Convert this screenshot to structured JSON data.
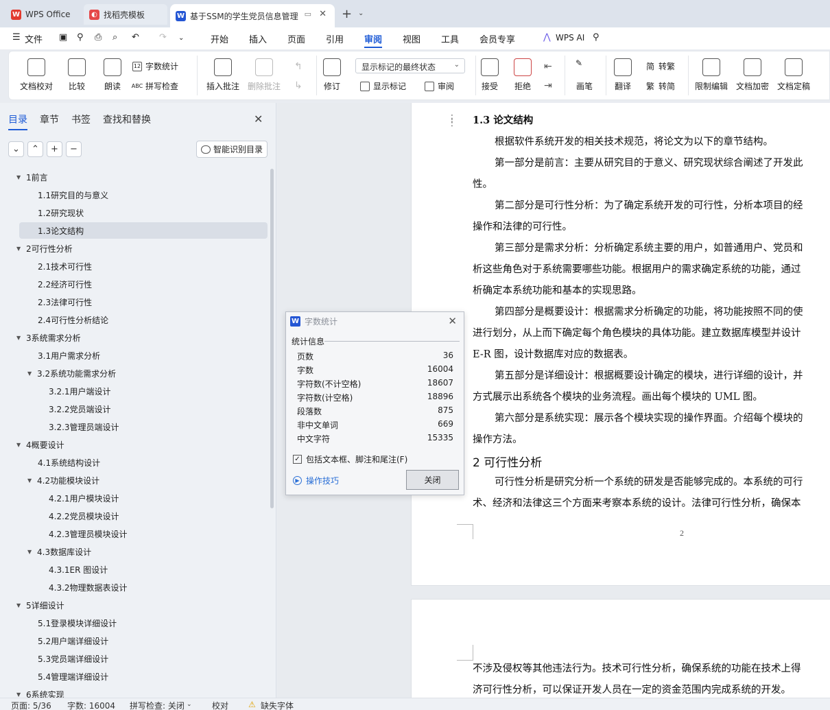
{
  "tabs": {
    "wps_home": "WPS Office",
    "template": "找稻壳模板",
    "document": "基于SSM的学生党员信息管理"
  },
  "menu": {
    "file": "文件",
    "items": [
      "开始",
      "插入",
      "页面",
      "引用",
      "审阅",
      "视图",
      "工具",
      "会员专享"
    ],
    "wps_ai": "WPS AI",
    "active": "审阅"
  },
  "ribbon": {
    "doc_check": "文档校对",
    "compare": "比较",
    "read_aloud": "朗读",
    "word_count": "字数统计",
    "spell_check": "拼写检查",
    "insert_comment": "插入批注",
    "delete_comment": "删除批注",
    "revise": "修订",
    "markup_dropdown": "显示标记的最终状态",
    "show_markup": "显示标记",
    "review": "审阅",
    "accept": "接受",
    "reject": "拒绝",
    "pen": "画笔",
    "translate": "翻译",
    "to_traditional": "转繁",
    "to_simplified": "转简",
    "trad_glyph": "简",
    "simp_glyph": "繁",
    "restrict_edit": "限制编辑",
    "encrypt": "文档加密",
    "finalize": "文档定稿"
  },
  "nav_panel": {
    "tabs": [
      "目录",
      "章节",
      "书签",
      "查找和替换"
    ],
    "active_tab": "目录",
    "smart_toc": "智能识别目录",
    "toc": [
      {
        "label": "1前言",
        "level": 1
      },
      {
        "label": "1.1研究目的与意义",
        "level": 2
      },
      {
        "label": "1.2研究现状",
        "level": 2
      },
      {
        "label": "1.3论文结构",
        "level": 2,
        "selected": true
      },
      {
        "label": "2可行性分析",
        "level": 1
      },
      {
        "label": "2.1技术可行性",
        "level": 2
      },
      {
        "label": "2.2经济可行性",
        "level": 2
      },
      {
        "label": "2.3法律可行性",
        "level": 2
      },
      {
        "label": "2.4可行性分析结论",
        "level": 2
      },
      {
        "label": "3系统需求分析",
        "level": 1
      },
      {
        "label": "3.1用户需求分析",
        "level": 2
      },
      {
        "label": "3.2系统功能需求分析",
        "level": 2,
        "expandable": true
      },
      {
        "label": "3.2.1用户端设计",
        "level": 3
      },
      {
        "label": "3.2.2党员端设计",
        "level": 3
      },
      {
        "label": "3.2.3管理员端设计",
        "level": 3
      },
      {
        "label": "4概要设计",
        "level": 1
      },
      {
        "label": "4.1系统结构设计",
        "level": 2
      },
      {
        "label": "4.2功能模块设计",
        "level": 2,
        "expandable": true
      },
      {
        "label": "4.2.1用户模块设计",
        "level": 3
      },
      {
        "label": "4.2.2党员模块设计",
        "level": 3
      },
      {
        "label": "4.2.3管理员模块设计",
        "level": 3
      },
      {
        "label": "4.3数据库设计",
        "level": 2,
        "expandable": true
      },
      {
        "label": "4.3.1ER 图设计",
        "level": 3
      },
      {
        "label": "4.3.2物理数据表设计",
        "level": 3
      },
      {
        "label": "5详细设计",
        "level": 1
      },
      {
        "label": "5.1登录模块详细设计",
        "level": 2
      },
      {
        "label": "5.2用户端详细设计",
        "level": 2
      },
      {
        "label": "5.3党员端详细设计",
        "level": 2
      },
      {
        "label": "5.4管理端详细设计",
        "level": 2
      },
      {
        "label": "6系统实现",
        "level": 1
      }
    ]
  },
  "document": {
    "lines": [
      {
        "text": "1.3  论文结构",
        "heading": true
      },
      {
        "text": "根据软件系统开发的相关技术规范，将论文为以下的章节结构。",
        "indent": true
      },
      {
        "text": "第一部分是前言：主要从研究目的于意义、研究现状综合阐述了开发此",
        "indent": true
      },
      {
        "text": "性。"
      },
      {
        "text": "第二部分是可行性分析：为了确定系统开发的可行性，分析本项目的经",
        "indent": true
      },
      {
        "text": "操作和法律的可行性。"
      },
      {
        "text": "第三部分是需求分析：分析确定系统主要的用户，如普通用户、党员和",
        "indent": true
      },
      {
        "text": "析这些角色对于系统需要哪些功能。根据用户的需求确定系统的功能，通过"
      },
      {
        "text": "析确定本系统功能和基本的实现思路。"
      },
      {
        "text": "第四部分是概要设计：根据需求分析确定的功能，将功能按照不同的使",
        "indent": true
      },
      {
        "text": "进行划分，从上而下确定每个角色模块的具体功能。建立数据库模型并设计"
      },
      {
        "text": "E-R 图，设计数据库对应的数据表。"
      },
      {
        "text": "第五部分是详细设计：根据概要设计确定的模块，进行详细的设计，并",
        "indent": true
      },
      {
        "text": "方式展示出系统各个模块的业务流程。画出每个模块的 UML 图。"
      },
      {
        "text": "第六部分是系统实现：展示各个模块实现的操作界面。介绍每个模块的",
        "indent": true
      },
      {
        "text": "操作方法。"
      },
      {
        "text": "2  可行性分析",
        "heading": true,
        "large": true
      },
      {
        "text": "可行性分析是研究分析一个系统的研发是否能够完成的。本系统的可行",
        "indent": true
      },
      {
        "text": "术、经济和法律这三个方面来考察本系统的设计。法律可行性分析，确保本"
      }
    ],
    "page_number": "2",
    "page2_lines": [
      "不涉及侵权等其他违法行为。技术可行性分析，确保系统的功能在技术上得",
      "济可行性分析，可以保证开发人员在一定的资金范围内完成系统的开发。"
    ]
  },
  "word_count_dialog": {
    "title": "字数统计",
    "group": "统计信息",
    "stats": [
      {
        "label": "页数",
        "value": "36"
      },
      {
        "label": "字数",
        "value": "16004"
      },
      {
        "label": "字符数(不计空格)",
        "value": "18607"
      },
      {
        "label": "字符数(计空格)",
        "value": "18896"
      },
      {
        "label": "段落数",
        "value": "875"
      },
      {
        "label": "非中文单词",
        "value": "669"
      },
      {
        "label": "中文字符",
        "value": "15335"
      }
    ],
    "include_label": "包括文本框、脚注和尾注(F)",
    "include_checked": true,
    "tips": "操作技巧",
    "close": "关闭"
  },
  "statusbar": {
    "page": "页面: 5/36",
    "words": "字数: 16004",
    "spell": "拼写检查: 关闭",
    "proof": "校对",
    "missing_font": "缺失字体"
  }
}
